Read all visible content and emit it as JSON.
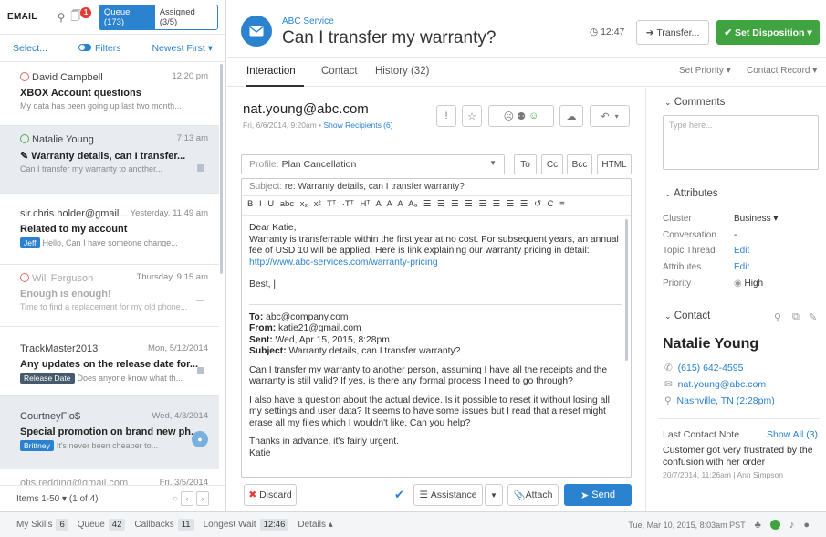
{
  "left": {
    "title": "EMAIL",
    "notif_count": "1",
    "queue_label": "Queue (173)",
    "assigned_label": "Assigned (3/5)",
    "select": "Select...",
    "filters": "Filters",
    "sort": "Newest First ▾",
    "conversations": [
      {
        "name": "David Campbell",
        "time": "12:20 pm",
        "subject": "XBOX Account questions",
        "preview": "My data has been going up last two month..."
      },
      {
        "name": "Natalie Young",
        "time": "7:13 am",
        "subject": "✎ Warranty details, can I transfer...",
        "preview": "Can I transfer my warranty to another..."
      },
      {
        "name": "sir.chris.holder@gmail...",
        "time": "Yesterday, 11:49 am",
        "subject": "Related to my account",
        "tag": "Jeff",
        "preview": "Hello, Can I have someone change..."
      },
      {
        "name": "Will Ferguson",
        "time": "Thursday, 9:15 am",
        "subject": "Enough is enough!",
        "preview": "Time to find a replacement for my old phone..."
      },
      {
        "name": "TrackMaster2013",
        "time": "Mon, 5/12/2014",
        "subject": "Any updates on the release date for...",
        "tag": "Release Date",
        "preview": "Does anyone know what th..."
      },
      {
        "name": "CourtneyFlo$",
        "time": "Wed, 4/3/2014",
        "subject": "Special promotion on brand new ph...",
        "tag": "Brittney",
        "preview": "It's never been cheaper to..."
      },
      {
        "name": "otis.redding@gmail.com",
        "time": "Fri, 3/5/2014",
        "subject": "",
        "preview": ""
      }
    ],
    "footer_items": "Items 1-50 ▾ (1 of 4)"
  },
  "header": {
    "service": "ABC Service",
    "title": "Can I transfer my warranty?",
    "clock": "12:47",
    "transfer": "Transfer...",
    "disposition": "Set Disposition ▾"
  },
  "tabs": {
    "interaction": "Interaction",
    "contact": "Contact",
    "history": "History (32)",
    "set_priority": "Set Priority ▾",
    "contact_record": "Contact Record ▾"
  },
  "email": {
    "from": "nat.young@abc.com",
    "date": "Fri, 6/6/2014, 9:20am •",
    "show_recipients": "Show Recipients (6)",
    "profile_label": "Profile:",
    "profile_value": "Plan Cancellation",
    "to": "To",
    "cc": "Cc",
    "bcc": "Bcc",
    "html": "HTML",
    "subject_label": "Subject:",
    "subject_value": "re: Warranty details, can I transfer warranty?",
    "toolbar": "B I U abc x₂ x² Tᵀ ·Tᵀ Hᵀ A A A Aₐ ☰ ☰ ☰ ☰ ☰ ☰ ☰ ☰ ↺ C ≡",
    "body_greeting": "Dear Katie,",
    "body_text": "Warranty is transferrable within the first year at no cost. For subsequent years, an annual fee of USD 10 will be applied. Here is link explaining our warranty pricing in detail:",
    "body_link": "http://www.abc-services.com/warranty-pricing",
    "body_sign": "Best, |",
    "q_to_label": "To:",
    "q_to": "abc@company.com",
    "q_from_label": "From:",
    "q_from": "katie21@gmail.com",
    "q_sent_label": "Sent:",
    "q_sent": "Wed, Apr 15, 2015, 8:28pm",
    "q_subject_label": "Subject:",
    "q_subject": "Warranty details, can I transfer warranty?",
    "q_p1": "Can I transfer my warranty to another person, assuming I have all the receipts and the warranty is still valid? If yes, is there any formal process I need to go through?",
    "q_p2": "I also have a question about the actual device. Is it possible to reset it without losing all my settings and user data? It seems to have some issues but I read that a reset might erase all my files which I wouldn't like. Can you help?",
    "q_p3": "Thanks in advance, it's fairly urgent.",
    "q_p4": "Katie",
    "discard": "Discard",
    "assistance": "Assistance",
    "attach": "Attach",
    "send": "Send"
  },
  "right": {
    "comments": "Comments",
    "comments_placeholder": "Type here...",
    "attributes": "Attributes",
    "attrs": [
      {
        "key": "Cluster",
        "value": "Business ▾"
      },
      {
        "key": "Conversation...",
        "value": "-"
      },
      {
        "key": "Topic Thread",
        "value": "Edit"
      },
      {
        "key": "Attributes",
        "value": "Edit"
      },
      {
        "key": "Priority",
        "value": "High"
      }
    ],
    "contact": "Contact",
    "contact_name": "Natalie Young",
    "phone": "(615) 642-4595",
    "email": "nat.young@abc.com",
    "location": "Nashville, TN (2:28pm)",
    "last_note_label": "Last Contact Note",
    "show_all": "Show All (3)",
    "note": "Customer got very frustrated by the confusion with her order",
    "note_meta": "20/7/2014, 11:26am | Ann Simpson"
  },
  "status": {
    "my_skills": "My Skills",
    "my_skills_n": "6",
    "queue": "Queue",
    "queue_n": "42",
    "callbacks": "Callbacks",
    "callbacks_n": "11",
    "longest_wait": "Longest Wait",
    "longest_wait_v": "12:46",
    "details": "Details ▴",
    "datetime": "Tue, Mar 10, 2015, 8:03am PST"
  },
  "colors": {
    "accent": "#2b82cf",
    "green": "#3fa43f",
    "red": "#e53935"
  }
}
